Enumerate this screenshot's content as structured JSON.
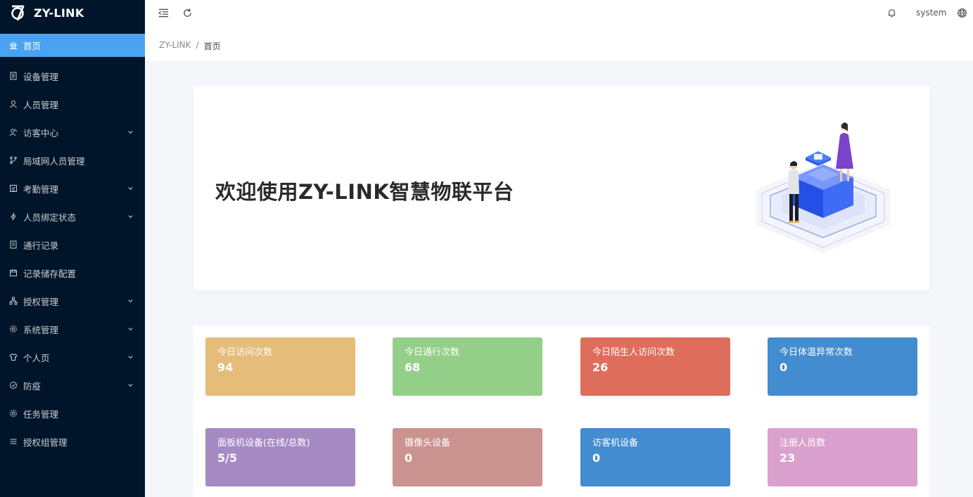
{
  "app": {
    "logo_text": "ZY-LINK"
  },
  "sidebar": {
    "items": [
      {
        "label": "首页",
        "icon": "home-icon",
        "active": true,
        "expandable": false
      },
      {
        "label": "设备管理",
        "icon": "device-icon",
        "expandable": false
      },
      {
        "label": "人员管理",
        "icon": "user-icon",
        "expandable": false
      },
      {
        "label": "访客中心",
        "icon": "visitor-icon",
        "expandable": true
      },
      {
        "label": "局域网人员管理",
        "icon": "branch-icon",
        "expandable": false
      },
      {
        "label": "考勤管理",
        "icon": "attendance-icon",
        "expandable": true
      },
      {
        "label": "人员绑定状态",
        "icon": "lightning-icon",
        "expandable": true
      },
      {
        "label": "通行记录",
        "icon": "record-icon",
        "expandable": false
      },
      {
        "label": "记录储存配置",
        "icon": "calendar-icon",
        "expandable": false
      },
      {
        "label": "授权管理",
        "icon": "org-icon",
        "expandable": true
      },
      {
        "label": "系统管理",
        "icon": "gear-icon",
        "expandable": true
      },
      {
        "label": "个人页",
        "icon": "shirt-icon",
        "expandable": true
      },
      {
        "label": "防疫",
        "icon": "shield-icon",
        "expandable": true
      },
      {
        "label": "任务管理",
        "icon": "settings-icon",
        "expandable": false
      },
      {
        "label": "授权组管理",
        "icon": "list-icon",
        "expandable": false
      }
    ]
  },
  "header": {
    "user": "system"
  },
  "breadcrumb": {
    "root": "ZY-LINK",
    "separator": "/",
    "current": "首页"
  },
  "welcome": {
    "title": "欢迎使用ZY-LINK智慧物联平台"
  },
  "stats": [
    {
      "label": "今日访问次数",
      "value": "94",
      "color": "#e6bc7a"
    },
    {
      "label": "今日通行次数",
      "value": "68",
      "color": "#93cf88"
    },
    {
      "label": "今日陌生人访问次数",
      "value": "26",
      "color": "#df6d5c"
    },
    {
      "label": "今日体温异常次数",
      "value": "0",
      "color": "#438ccf"
    },
    {
      "label": "面板机设备(在线/总数)",
      "value": "5/5",
      "color": "#a68ac4"
    },
    {
      "label": "摄像头设备",
      "value": "0",
      "color": "#cb9390"
    },
    {
      "label": "访客机设备",
      "value": "0",
      "color": "#438ccf"
    },
    {
      "label": "注册人员数",
      "value": "23",
      "color": "#dba1ce"
    }
  ]
}
